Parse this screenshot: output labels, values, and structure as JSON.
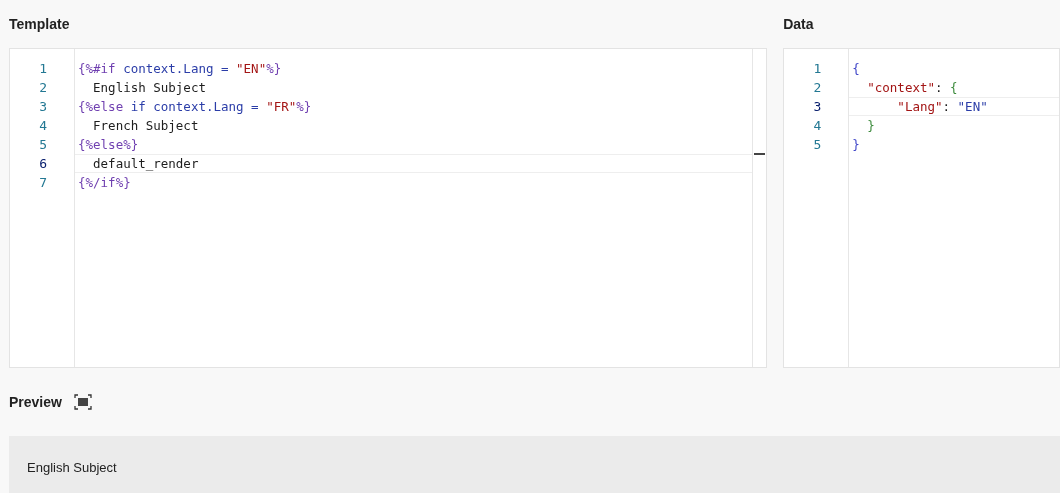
{
  "template": {
    "title": "Template",
    "lines": [
      {
        "number": "1",
        "current": false,
        "tokens": [
          {
            "kind": "tag",
            "text": "{%#if"
          },
          {
            "kind": "keyword",
            "text": " context.Lang = "
          },
          {
            "kind": "string",
            "text": "\"EN\""
          },
          {
            "kind": "tag",
            "text": "%}"
          }
        ]
      },
      {
        "number": "2",
        "current": false,
        "tokens": [
          {
            "kind": "text",
            "text": "  English Subject"
          }
        ]
      },
      {
        "number": "3",
        "current": false,
        "tokens": [
          {
            "kind": "tag",
            "text": "{%else"
          },
          {
            "kind": "keyword",
            "text": " if context.Lang = "
          },
          {
            "kind": "string",
            "text": "\"FR\""
          },
          {
            "kind": "tag",
            "text": "%}"
          }
        ]
      },
      {
        "number": "4",
        "current": false,
        "tokens": [
          {
            "kind": "text",
            "text": "  French Subject"
          }
        ]
      },
      {
        "number": "5",
        "current": false,
        "tokens": [
          {
            "kind": "tag",
            "text": "{%else%}"
          }
        ]
      },
      {
        "number": "6",
        "current": true,
        "tokens": [
          {
            "kind": "text",
            "text": "  default_render"
          }
        ]
      },
      {
        "number": "7",
        "current": false,
        "tokens": [
          {
            "kind": "tag",
            "text": "{%/if%}"
          }
        ]
      }
    ]
  },
  "data": {
    "title": "Data",
    "lines": [
      {
        "number": "1",
        "current": false,
        "tokens": [
          {
            "kind": "brace",
            "text": "{"
          }
        ]
      },
      {
        "number": "2",
        "current": false,
        "tokens": [
          {
            "kind": "key",
            "text": "  \"context\""
          },
          {
            "kind": "punct",
            "text": ": "
          },
          {
            "kind": "brace2",
            "text": "{"
          }
        ]
      },
      {
        "number": "3",
        "current": true,
        "tokens": [
          {
            "kind": "key",
            "text": "      \"Lang\""
          },
          {
            "kind": "punct",
            "text": ": "
          },
          {
            "kind": "value",
            "text": "\"EN\""
          }
        ]
      },
      {
        "number": "4",
        "current": false,
        "tokens": [
          {
            "kind": "brace2",
            "text": "  }"
          }
        ]
      },
      {
        "number": "5",
        "current": false,
        "tokens": [
          {
            "kind": "brace",
            "text": "}"
          }
        ]
      }
    ]
  },
  "preview": {
    "title": "Preview",
    "text": "English Subject"
  }
}
